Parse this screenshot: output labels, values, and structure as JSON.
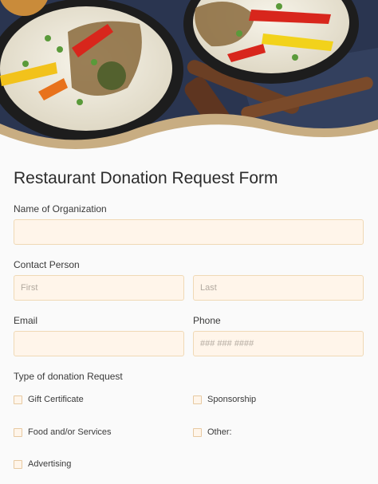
{
  "form": {
    "title": "Restaurant Donation Request Form",
    "organization": {
      "label": "Name of Organization",
      "value": ""
    },
    "contact": {
      "label": "Contact Person",
      "first_placeholder": "First",
      "last_placeholder": "Last"
    },
    "email": {
      "label": "Email",
      "value": ""
    },
    "phone": {
      "label": "Phone",
      "placeholder": "### ### ####"
    },
    "donation_type": {
      "label": "Type of donation Request",
      "options": [
        "Gift Certificate",
        "Sponsorship",
        "Food and/or Services",
        "Other:",
        "Advertising"
      ]
    }
  },
  "colors": {
    "accent": "#f0d9b5",
    "field_bg": "#fff5ea"
  }
}
